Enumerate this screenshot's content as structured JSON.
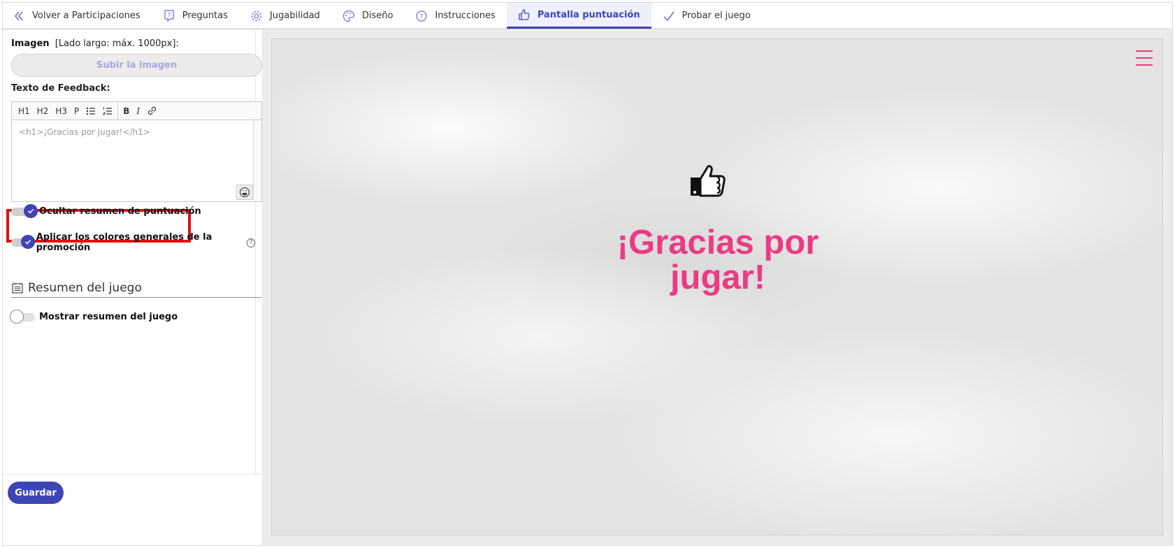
{
  "nav": {
    "back_label": "Volver a Participaciones",
    "tabs": [
      {
        "label": "Preguntas",
        "icon": "question-bubble-icon"
      },
      {
        "label": "Jugabilidad",
        "icon": "gear-icon"
      },
      {
        "label": "Diseño",
        "icon": "palette-icon"
      },
      {
        "label": "Instrucciones",
        "icon": "question-circle-icon"
      },
      {
        "label": "Pantalla puntuación",
        "icon": "thumbs-up-icon",
        "active": true
      },
      {
        "label": "Probar el juego",
        "icon": "checkmark-icon"
      }
    ]
  },
  "left": {
    "image_label": "Imagen",
    "image_hint": "[Lado largo: máx. 1000px]:",
    "upload_label": "Subir la imagen",
    "feedback_label": "Texto de Feedback:",
    "toolbar": [
      "H1",
      "H2",
      "H3",
      "P",
      "B",
      "I"
    ],
    "editor_text": "<h1>¡Gracias por jugar!</h1>",
    "toggle_hide_score": "Ocultar resumen de puntuación",
    "toggle_colors": "Aplicar los colores generales de la promoción",
    "help_glyph": "?",
    "section_title": "Resumen del juego",
    "toggle_show_summary": "Mostrar resumen del juego",
    "save_label": "Guardar"
  },
  "preview": {
    "line1": "¡Gracias por",
    "line2": "jugar!",
    "accent": "#ec3b83"
  },
  "colors": {
    "primary": "#3f44b5",
    "highlight": "#e01010"
  }
}
